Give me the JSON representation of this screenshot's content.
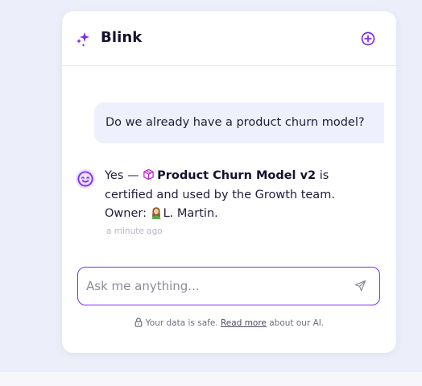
{
  "app": {
    "title": "Blink"
  },
  "icons": {
    "brand": "sparkles-icon",
    "new_chat": "plus-circle-icon",
    "bot_avatar": "bot-face-icon",
    "entity": "cube-icon",
    "owner_avatar": "user-avatar-icon",
    "send": "send-icon",
    "lock": "lock-icon"
  },
  "colors": {
    "accent": "#7b2df0",
    "user_bubble": "#eef1fd",
    "background": "#eceef9"
  },
  "conversation": {
    "user_message": "Do we already have a product churn model?",
    "bot_reply": {
      "prefix": "Yes — ",
      "entity_name": "Product Churn Model v2",
      "suffix": " is",
      "line2": "certified and used by the Growth team.",
      "owner_label": "Owner:",
      "owner_name": "L. Martin.",
      "timestamp": "a minute ago"
    }
  },
  "composer": {
    "placeholder": "Ask me anything..."
  },
  "footer": {
    "text_before": "Your data is safe.",
    "link": "Read more",
    "text_after": "about our AI."
  }
}
